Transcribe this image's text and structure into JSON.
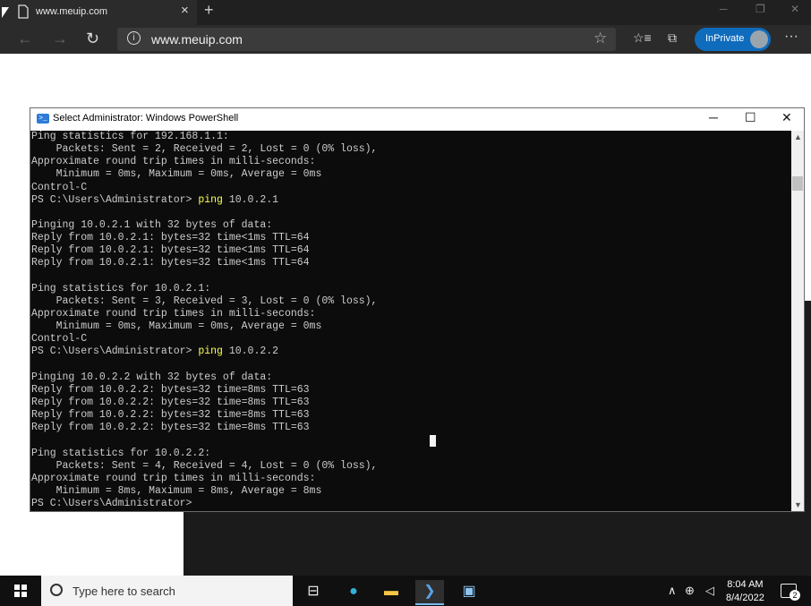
{
  "browser": {
    "tab_title": "www.meuip.com",
    "url": "www.meuip.com",
    "inprivate_label": "InPrivate"
  },
  "powershell": {
    "title": "Select Administrator: Windows PowerShell",
    "lines": [
      {
        "text": "Ping statistics for 192.168.1.1:"
      },
      {
        "text": "    Packets: Sent = 2, Received = 2, Lost = 0 (0% loss),"
      },
      {
        "text": "Approximate round trip times in milli-seconds:"
      },
      {
        "text": "    Minimum = 0ms, Maximum = 0ms, Average = 0ms"
      },
      {
        "text": "Control-C"
      },
      {
        "prompt": "PS C:\\Users\\Administrator> ",
        "cmd": "ping",
        "args": " 10.0.2.1"
      },
      {
        "text": ""
      },
      {
        "text": "Pinging 10.0.2.1 with 32 bytes of data:"
      },
      {
        "text": "Reply from 10.0.2.1: bytes=32 time<1ms TTL=64"
      },
      {
        "text": "Reply from 10.0.2.1: bytes=32 time<1ms TTL=64"
      },
      {
        "text": "Reply from 10.0.2.1: bytes=32 time<1ms TTL=64"
      },
      {
        "text": ""
      },
      {
        "text": "Ping statistics for 10.0.2.1:"
      },
      {
        "text": "    Packets: Sent = 3, Received = 3, Lost = 0 (0% loss),"
      },
      {
        "text": "Approximate round trip times in milli-seconds:"
      },
      {
        "text": "    Minimum = 0ms, Maximum = 0ms, Average = 0ms"
      },
      {
        "text": "Control-C"
      },
      {
        "prompt": "PS C:\\Users\\Administrator> ",
        "cmd": "ping",
        "args": " 10.0.2.2"
      },
      {
        "text": ""
      },
      {
        "text": "Pinging 10.0.2.2 with 32 bytes of data:"
      },
      {
        "text": "Reply from 10.0.2.2: bytes=32 time=8ms TTL=63"
      },
      {
        "text": "Reply from 10.0.2.2: bytes=32 time=8ms TTL=63"
      },
      {
        "text": "Reply from 10.0.2.2: bytes=32 time=8ms TTL=63"
      },
      {
        "text": "Reply from 10.0.2.2: bytes=32 time=8ms TTL=63"
      },
      {
        "text": ""
      },
      {
        "text": "Ping statistics for 10.0.2.2:"
      },
      {
        "text": "    Packets: Sent = 4, Received = 4, Lost = 0 (0% loss),"
      },
      {
        "text": "Approximate round trip times in milli-seconds:"
      },
      {
        "text": "    Minimum = 8ms, Maximum = 8ms, Average = 8ms"
      },
      {
        "text": "PS C:\\Users\\Administrator>"
      }
    ]
  },
  "taskbar": {
    "search_placeholder": "Type here to search",
    "time": "8:04 AM",
    "date": "8/4/2022",
    "notification_count": "2"
  }
}
